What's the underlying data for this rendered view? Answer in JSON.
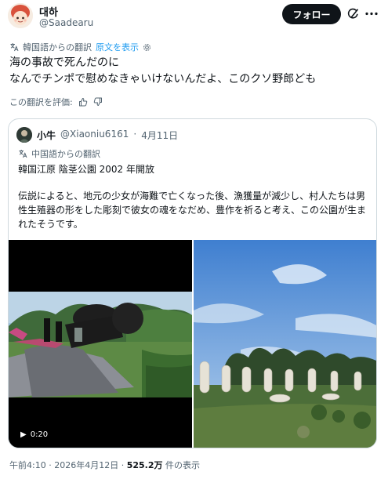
{
  "author": {
    "display_name": "대하",
    "handle": "@Saadearu",
    "follow_label": "フォロー",
    "avatar_icon": "anime-avatar-icon",
    "grok_icon": "grok-icon",
    "more_icon": "more-options-icon"
  },
  "translation": {
    "source_label": "韓国語からの翻訳",
    "show_original_label": "原文を表示",
    "settings_icon": "gear-icon"
  },
  "tweet": {
    "line1": "海の事故で死んだのに",
    "line2": "なんでチンポで慰めなきゃいけないんだよ、このクソ野郎ども"
  },
  "rate": {
    "label": "この翻訳を評価:",
    "thumbs_up_icon": "thumbs-up-icon",
    "thumbs_down_icon": "thumbs-down-icon"
  },
  "quote": {
    "display_name": "小牛",
    "handle": "@Xiaoniu6161",
    "separator": "·",
    "date": "4月11日",
    "translation_label": "中国語からの翻訳",
    "line1": "韓国江原 陰茎公園 2002 年開放",
    "body": "伝説によると、地元の少女が海難で亡くなった後、漁獲量が減少し、村人たちは男性生殖器の形をした彫刻で彼女の魂をなだめ、豊作を祈ると考え、この公園が生まれたそうです。",
    "video_duration": "0:20"
  },
  "meta": {
    "time": "午前4:10",
    "dot": "·",
    "date": "2026年4月12日",
    "views_count": "525.2万",
    "views_label": "件の表示"
  },
  "colors": {
    "accent": "#1d9bf0",
    "text": "#0f1419",
    "muted": "#536471",
    "border": "#cfd9de"
  }
}
